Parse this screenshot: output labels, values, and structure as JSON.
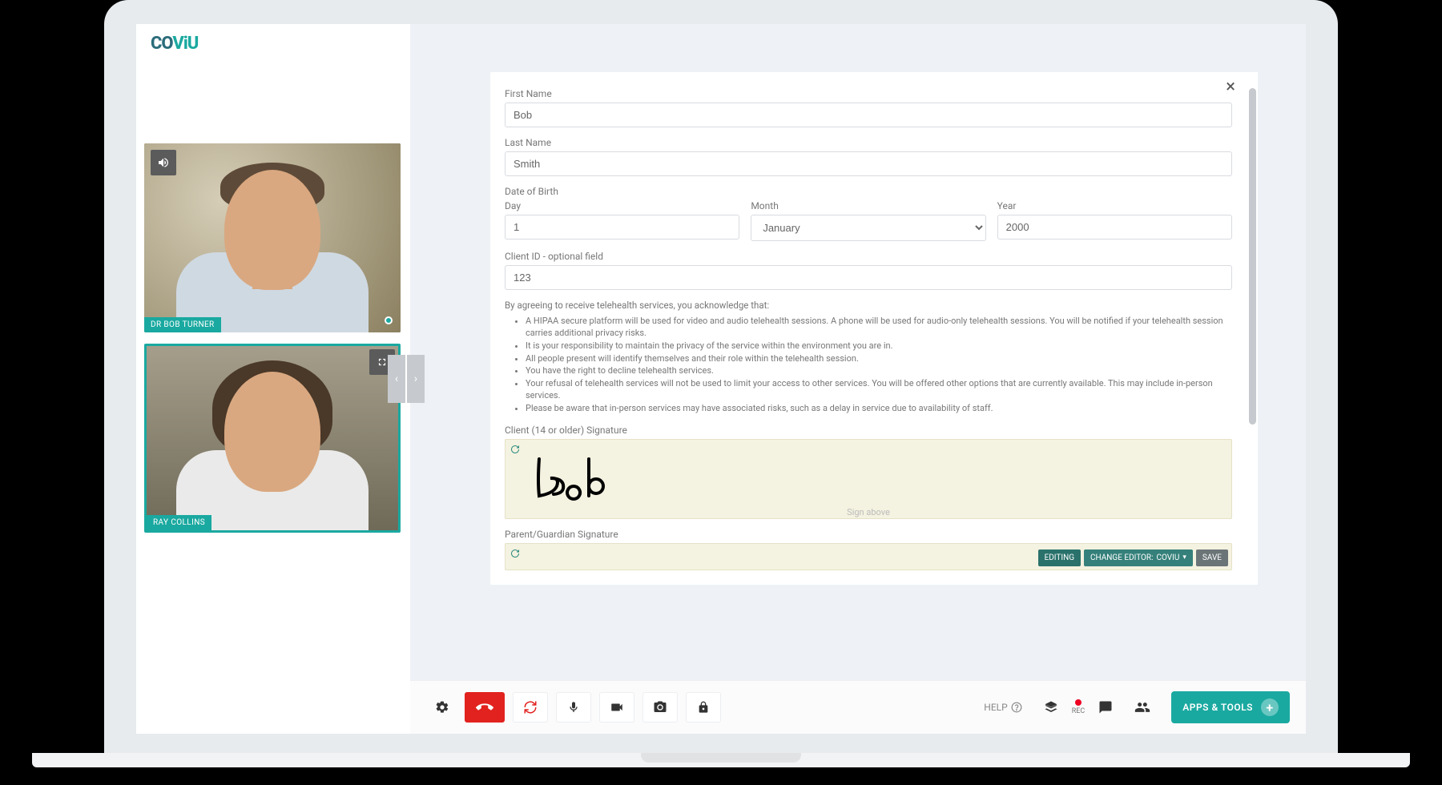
{
  "brand": {
    "co": "CO",
    "viu": "ViU"
  },
  "participants": [
    {
      "name": "DR BOB TURNER",
      "self": false
    },
    {
      "name": "RAY COLLINS",
      "self": true
    }
  ],
  "form": {
    "first_name": {
      "label": "First Name",
      "value": "Bob"
    },
    "last_name": {
      "label": "Last Name",
      "value": "Smith"
    },
    "dob_label": "Date of Birth",
    "dob": {
      "day": {
        "label": "Day",
        "value": "1"
      },
      "month": {
        "label": "Month",
        "value": "January"
      },
      "year": {
        "label": "Year",
        "value": "2000"
      }
    },
    "client_id": {
      "label": "Client ID - optional field",
      "value": "123"
    },
    "consent_intro": "By agreeing to receive telehealth services, you acknowledge that:",
    "consent_items": [
      "A HIPAA secure platform will be used for video and audio telehealth sessions. A phone will be used for audio-only telehealth sessions. You will be notified if your telehealth session carries additional privacy risks.",
      "It is your responsibility to maintain the privacy of the service within the environment you are in.",
      "All people present will identify themselves and their role within the telehealth session.",
      "You have the right to decline telehealth services.",
      "Your refusal of telehealth services will not be used to limit your access to other services. You will be offered other options that are currently available. This may include in-person services.",
      "Please be aware that in-person services may have associated risks, such as a delay in service due to availability of staff."
    ],
    "client_sig_label": "Client (14 or older) Signature",
    "sign_above": "Sign above",
    "parent_sig_label": "Parent/Guardian Signature"
  },
  "form_actions": {
    "editing": "EDITING",
    "change_editor": "CHANGE EDITOR:",
    "editor_value": "COVIU",
    "save": "SAVE"
  },
  "footer": {
    "help": "HELP",
    "rec": "REC",
    "apps": "APPS & TOOLS"
  }
}
